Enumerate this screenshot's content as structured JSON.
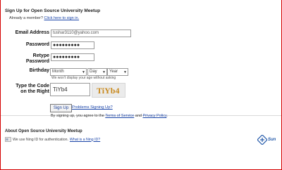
{
  "form": {
    "heading": "Sign Up for Open Source University Meetup",
    "already_member": "Already a member?",
    "sign_in_link": "Click here to sign in.",
    "email_label": "Email Address",
    "email_value": "tushar3110@yahoo.com",
    "password_label": "Password",
    "password_value": "●●●●●●●●●",
    "retype_label_1": "Retype",
    "retype_label_2": "Password",
    "retype_value": "●●●●●●●●●",
    "birthday_label": "Birthday",
    "month_value": "Month",
    "day_value": "Day",
    "year_value": "Year",
    "birthday_note": "We won't display your age without asking",
    "captcha_label_1": "Type the Code",
    "captcha_label_2": "on the Right",
    "captcha_input_value": "TiYb4",
    "captcha_image_text": "TiYb4",
    "sign_up_button": "Sign Up",
    "problems_link": "Problems Signing Up?",
    "terms_prefix": "By signing up, you agree to the",
    "terms_link": "Terms of Service",
    "terms_and": "and",
    "privacy_link": "Privacy Policy",
    "terms_suffix": "."
  },
  "about": {
    "heading": "About Open Source University Meetup",
    "ning_text": "We use Ning ID for authentication.",
    "ning_link": "What is a Ning ID?",
    "logo_text": "Sun"
  },
  "colors": {
    "frame_border": "#d40000",
    "link": "#1a44a8"
  },
  "icons": [
    "dropdown-arrow-icon",
    "ning-id-icon",
    "sun-logo-icon"
  ]
}
